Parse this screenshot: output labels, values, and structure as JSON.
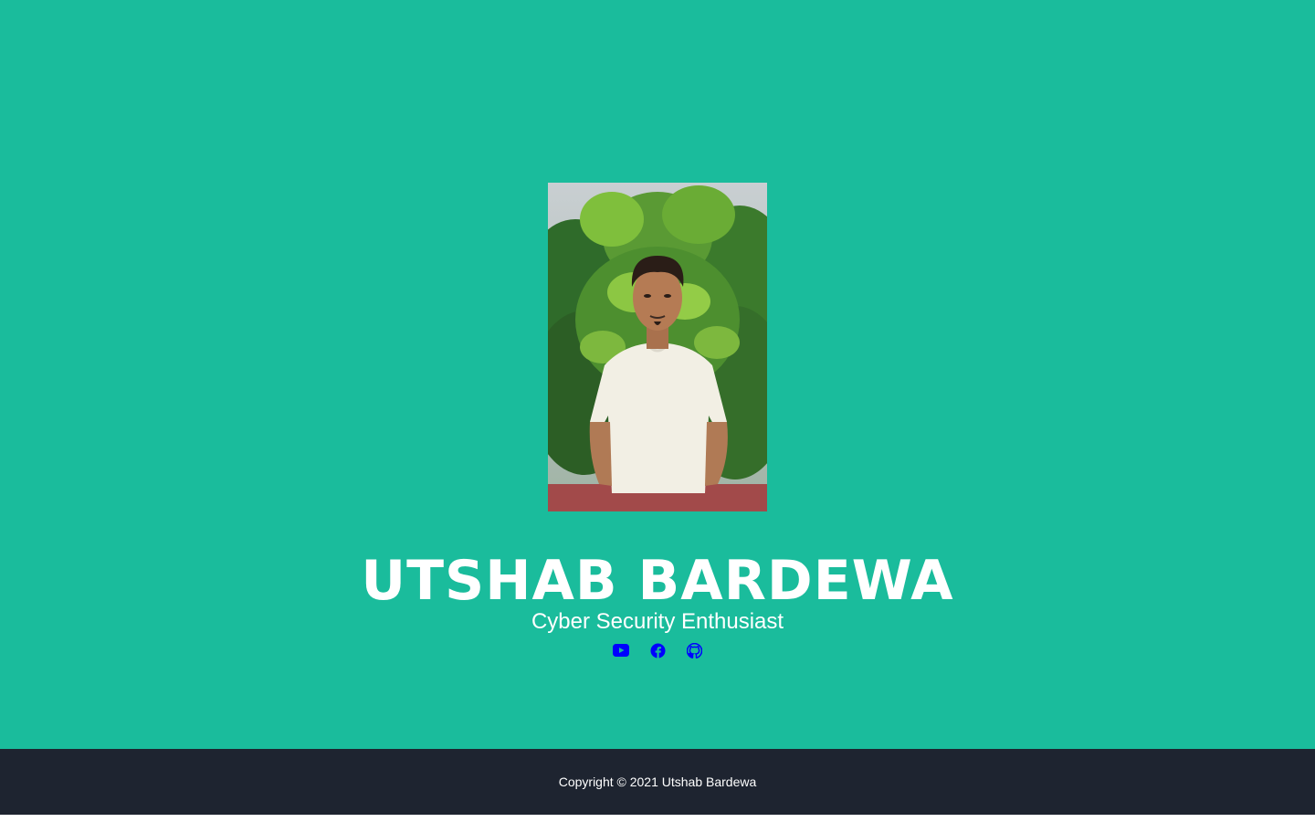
{
  "profile": {
    "name": "UTSHAB BARDEWA",
    "tagline": "Cyber Security Enthusiast",
    "photo_alt": "Utshab Bardewa portrait"
  },
  "social_links": [
    {
      "name": "youtube",
      "icon": "youtube-icon"
    },
    {
      "name": "facebook",
      "icon": "facebook-icon"
    },
    {
      "name": "github",
      "icon": "github-icon"
    }
  ],
  "footer": {
    "copyright": "Copyright © 2021 Utshab Bardewa"
  },
  "colors": {
    "hero_background": "#1abc9c",
    "footer_background": "#1e2430",
    "text": "#ffffff",
    "icon": "#0000ff"
  }
}
